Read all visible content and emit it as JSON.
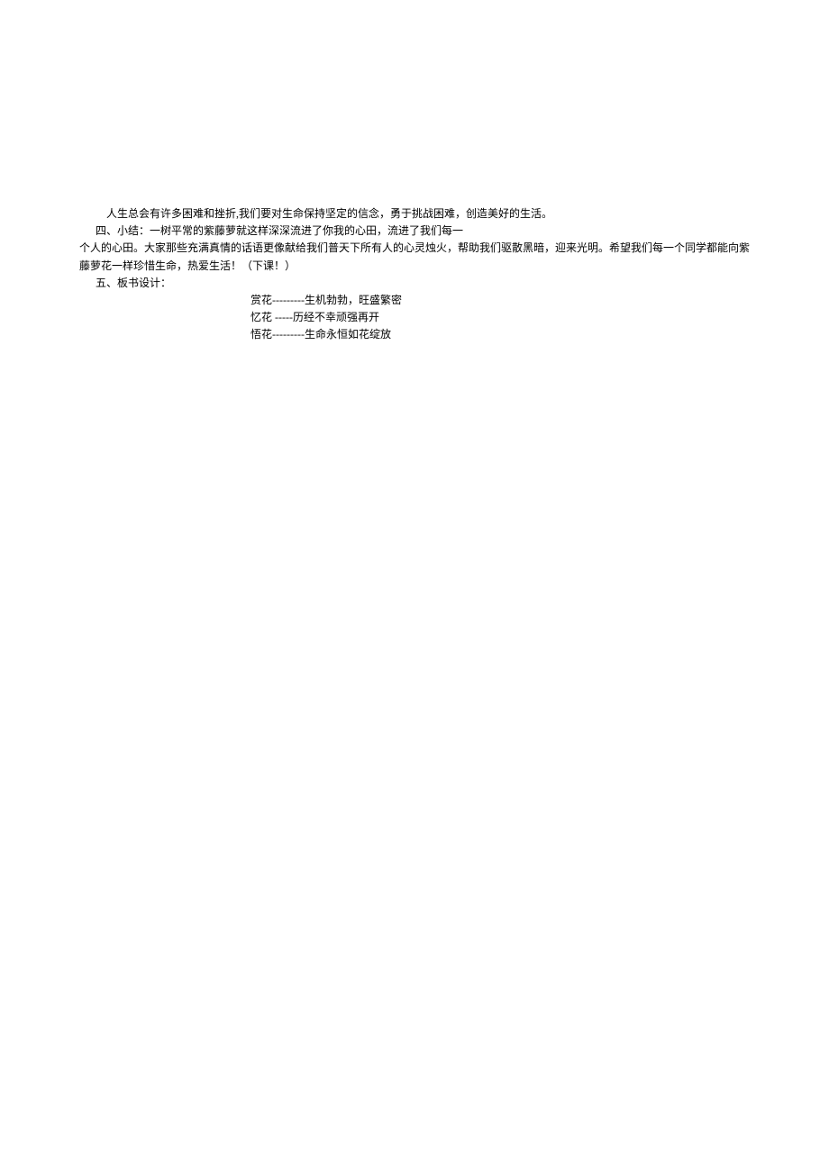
{
  "paragraphs": {
    "p1": "人生总会有许多困难和挫折,我们要对生命保持坚定的信念，勇于挑战困难，创造美好的生活。",
    "p2": "四、小结：一树平常的紫藤萝就这样深深流进了你我的心田，流进了我们每一",
    "p3": "个人的心田。大家那些充满真情的话语更像献给我们普天下所有人的心灵烛火，帮助我们驱散黑暗，迎来光明。希望我们每一个同学都能向紫藤萝花一样珍惜生命，热爱生活！（下课！）",
    "p4": "五、板书设计："
  },
  "board": {
    "line1": "赏花---------生机勃勃，旺盛繁密",
    "line2": "忆花 -----历经不幸顽强再开",
    "line3": "悟花---------生命永恒如花绽放"
  }
}
